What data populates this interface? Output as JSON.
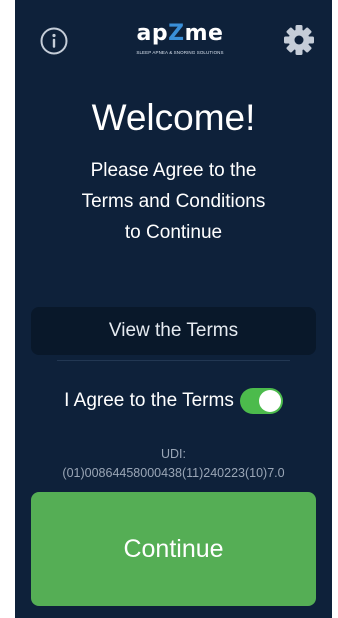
{
  "header": {
    "info_icon": "info-circle-icon",
    "settings_icon": "gear-icon",
    "logo": {
      "wordmark_prefix": "ap",
      "wordmark_z": "Z",
      "wordmark_suffix": "me",
      "tagline": "SLEEP APNEA & SNORING SOLUTIONS"
    }
  },
  "main": {
    "title": "Welcome!",
    "prompt_line1": "Please Agree to the",
    "prompt_line2": "Terms and Conditions",
    "prompt_line3": "to Continue",
    "view_terms_label": "View the Terms",
    "agree_label": "I Agree to the Terms",
    "agree_checked": true,
    "udi_label": "UDI:",
    "udi_value": "(01)00864458000438(11)240223(10)7.0",
    "continue_label": "Continue"
  },
  "colors": {
    "background": "#0e213a",
    "button_dark": "#09182a",
    "toggle_on": "#4cbb4c",
    "continue_green": "#55ae55",
    "udi_text": "#9aa6b6",
    "logo_accent": "#3a8fd8"
  }
}
